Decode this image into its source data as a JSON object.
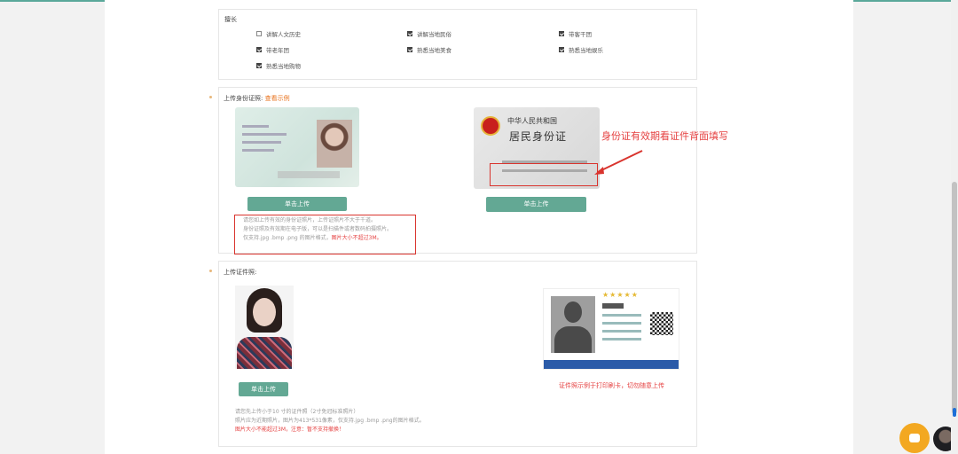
{
  "hobbies": {
    "label": "擅长",
    "items": [
      {
        "label": "讲解人文历史",
        "checked": false
      },
      {
        "label": "讲解当地民俗",
        "checked": true
      },
      {
        "label": "带客干团",
        "checked": true
      },
      {
        "label": "带老年团",
        "checked": true
      },
      {
        "label": "熟悉当地美食",
        "checked": true
      },
      {
        "label": "熟悉当地娱乐",
        "checked": true
      },
      {
        "label": "熟悉当地购物",
        "checked": true
      }
    ]
  },
  "idcard": {
    "label": "上传身份证照:",
    "example_link": "查看示例",
    "front_upload_btn": "单击上传",
    "back_upload_btn": "单击上传",
    "back_title": "中华人民共和国",
    "back_subtitle": "居民身份证",
    "annotation": "身份证有效期看证件背面填写",
    "note_line1": "请您如上传有效的身份证照片，上传证照片不大于千道。",
    "note_line2": "身份证照及有效期在电子版，可以是扫描件或者数码拍摄照片。",
    "note_line3": "仅支持.jpg .bmp .png 的图片格式，",
    "note_line3_red": "图片大小不超过3M。"
  },
  "photo": {
    "label": "上传证件照:",
    "upload_btn": "单击上传",
    "warning": "证件照示例于打印刷卡，切勿随意上传",
    "note_line1": "请您先上传小于10 寸的证件照（2寸免冠标准照片）",
    "note_line2": "照片应为近期照片，图片为413*531像素，仅支持.jpg .bmp .png的图片格式。",
    "note_line3_red": "图片大小不能超过3M，注意：暂不支持撤换！"
  },
  "colors": {
    "accent": "#63a894",
    "annotation_red": "#e54040",
    "link_orange": "#e8731e"
  },
  "icons": [
    "check-icon",
    "chat-icon",
    "avatar"
  ]
}
